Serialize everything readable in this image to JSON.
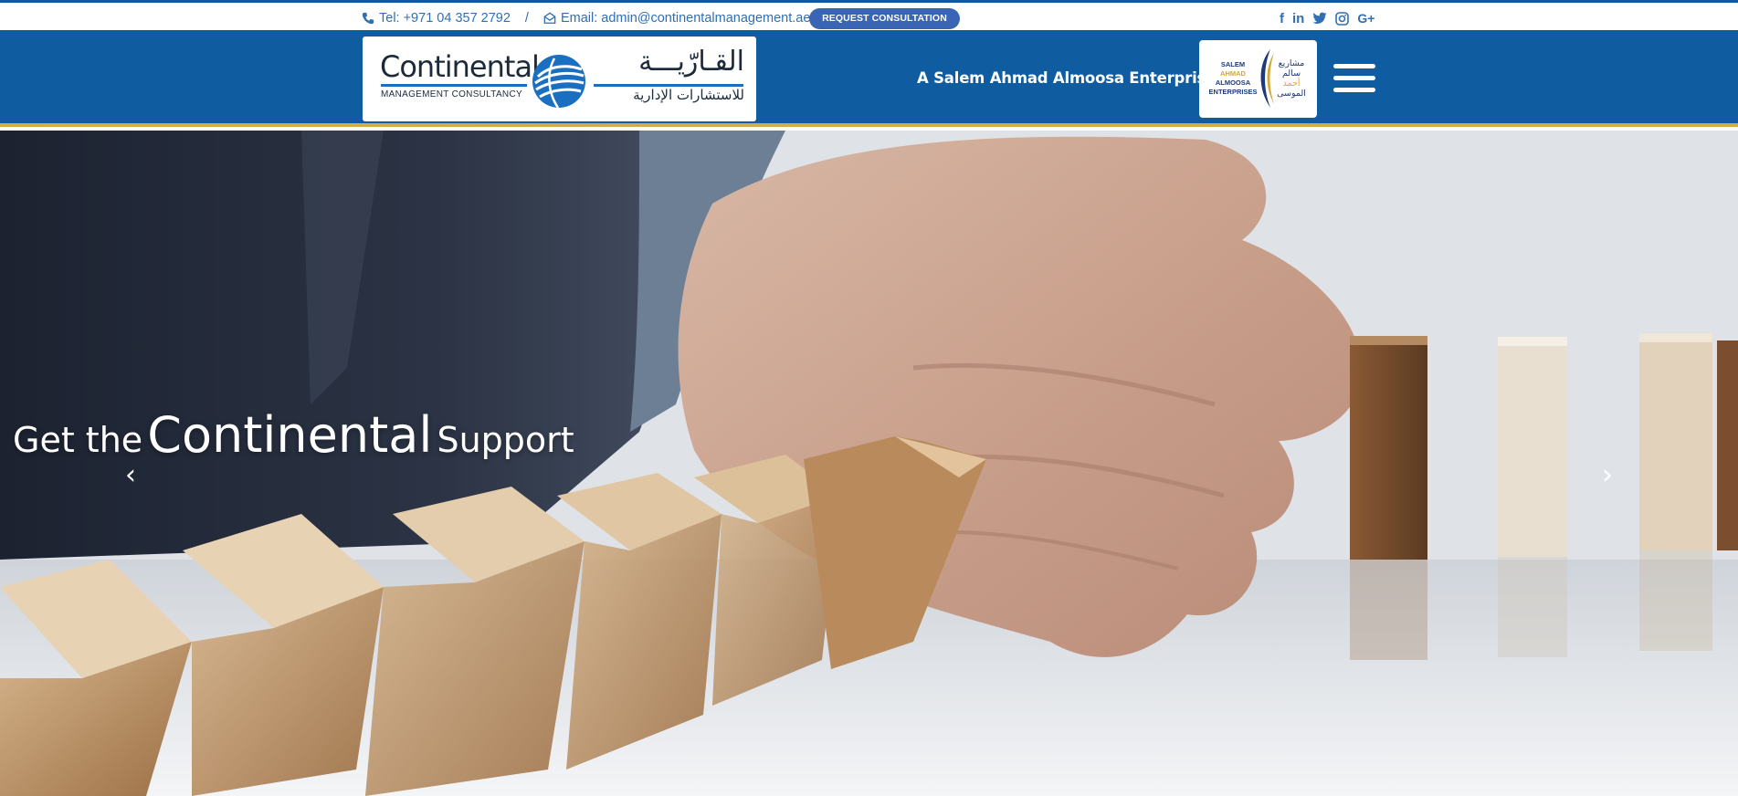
{
  "topbar": {
    "phone": "Tel: +971 04 357 2792",
    "separator": "/",
    "email": "Email: admin@continentalmanagement.ae",
    "consult_button": "REQUEST CONSULTATION",
    "social_icons": [
      "facebook-icon",
      "linkedin-icon",
      "twitter-icon",
      "instagram-icon",
      "google-plus-icon"
    ]
  },
  "header": {
    "logo": {
      "en_name": "Continental",
      "en_sub": "MANAGEMENT CONSULTANCY",
      "ar_name": "القـارّيـــة",
      "ar_sub": "للاستشارات الإدارية"
    },
    "enterprise_tag": "A Salem Ahmad Almoosa Enterprise",
    "saa_logo": {
      "en": [
        "SALEM",
        "AHMAD",
        "ALMOOSA",
        "ENTERPRISES"
      ],
      "ar": [
        "مشاريع",
        "سالم",
        "أحمد",
        "الموسى"
      ]
    }
  },
  "hero": {
    "headline_part1": "Get the",
    "headline_part2": "Continental",
    "headline_part3": "Support",
    "prev_icon": "chevron-left-icon",
    "next_icon": "chevron-right-icon"
  },
  "colors": {
    "brand_blue": "#105ca0",
    "accent_gold": "#d8a94a",
    "link_blue": "#2f6fb3",
    "button_blue": "#3a64b4"
  }
}
